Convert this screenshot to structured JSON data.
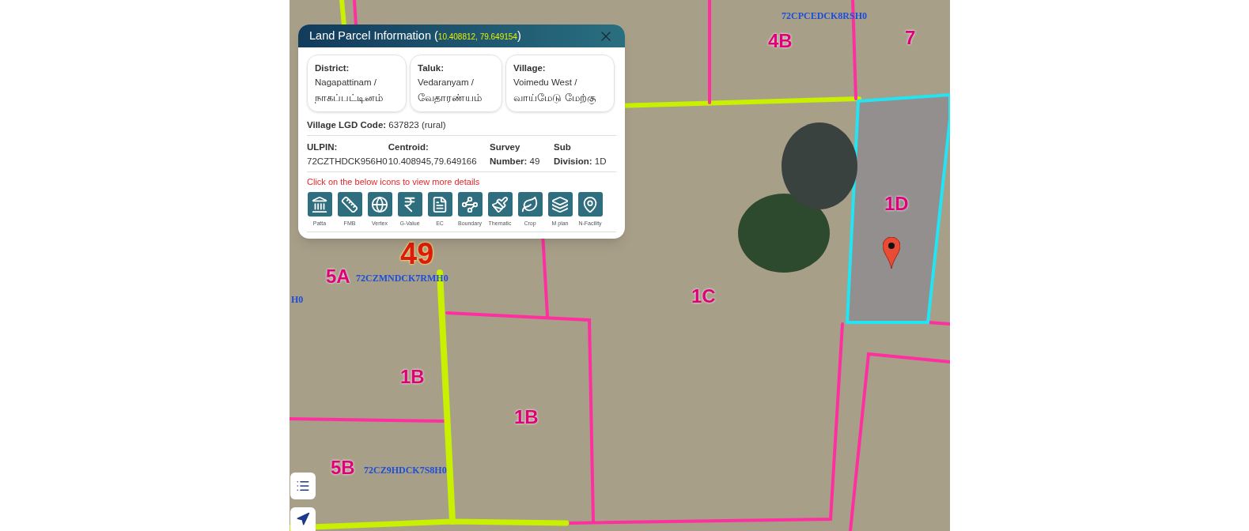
{
  "popup": {
    "title": "Land Parcel Information",
    "open": "(",
    "coordinates": "10.408812, 79.649154",
    "close": ")",
    "cards": [
      {
        "label": "District:",
        "value": "Nagapattinam /",
        "value_local": "நாகப்பட்டினம்"
      },
      {
        "label": "Taluk:",
        "value": "Vedaranyam /",
        "value_local": "வேதாரண்யம்"
      },
      {
        "label": "Village:",
        "value": "Voimedu West /",
        "value_local": "வாய்மேடு மேற்கு"
      }
    ],
    "lgd": {
      "label": "Village LGD Code:",
      "value": "637823 (rural)"
    },
    "details": [
      {
        "kind": "stacked",
        "label": "ULPIN:",
        "value": "72CZTHDCK956H0"
      },
      {
        "kind": "stacked",
        "label": "Centroid:",
        "value": "10.408945,79.649166"
      },
      {
        "kind": "split",
        "label_top": "Survey",
        "label": "Number:",
        "value": "49"
      },
      {
        "kind": "split",
        "label_top": "Sub",
        "label": "Division:",
        "value": "1D"
      }
    ],
    "hint": "Click on the below icons to view more details",
    "actions": [
      {
        "kind": "landmark",
        "label": "Patta"
      },
      {
        "kind": "ruler",
        "label": "FMB"
      },
      {
        "kind": "globe",
        "label": "Vertex"
      },
      {
        "kind": "rupee",
        "label": "G-Value"
      },
      {
        "kind": "file",
        "label": "EC"
      },
      {
        "kind": "boundary",
        "label": "Boundary"
      },
      {
        "kind": "brush",
        "label": "Thematic"
      },
      {
        "kind": "leaf",
        "label": "Crop"
      },
      {
        "kind": "layers",
        "label": "M plan"
      },
      {
        "kind": "pin",
        "label": "N-Facility"
      }
    ]
  },
  "map_labels": [
    {
      "kind": "ulpin",
      "text": "72CPCEDCK8RSH0"
    },
    {
      "kind": "sub",
      "text": "4B"
    },
    {
      "kind": "sub",
      "text": "7"
    },
    {
      "kind": "survey",
      "text": "49"
    },
    {
      "kind": "sub",
      "text": "5A"
    },
    {
      "kind": "ulpin",
      "text": "72CZMNDCK7RMH0"
    },
    {
      "kind": "sub",
      "text": "1C"
    },
    {
      "kind": "sub",
      "text": "1D"
    },
    {
      "kind": "sub",
      "text": "1B"
    },
    {
      "kind": "sub",
      "text": "1B"
    },
    {
      "kind": "sub",
      "text": "5B"
    },
    {
      "kind": "ulpin",
      "text": "72CZ9HDCK7S8H0"
    },
    {
      "kind": "ulpin",
      "text": "H0"
    }
  ]
}
